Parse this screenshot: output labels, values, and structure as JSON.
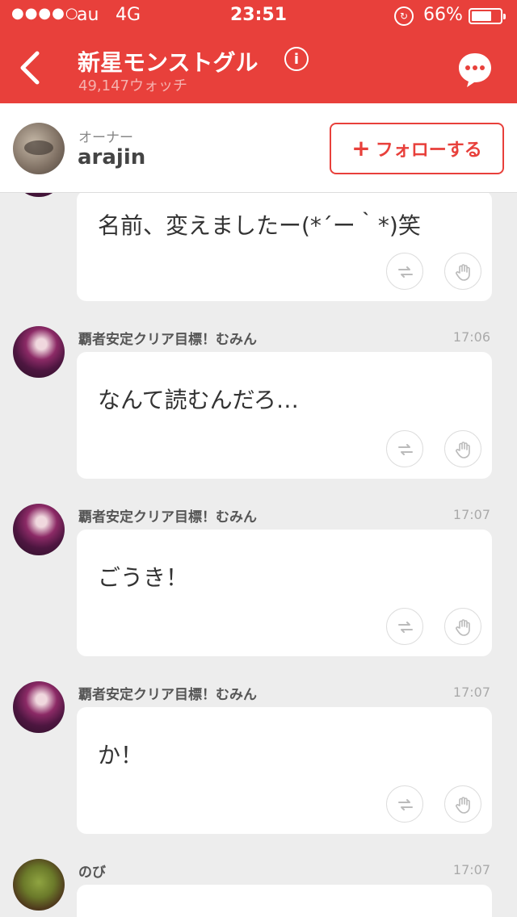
{
  "status": {
    "signal": "●●●●○",
    "carrier": "au",
    "network": "4G",
    "time": "23:51",
    "battery": "66%"
  },
  "header": {
    "title": "新星モンストグル",
    "watchers": "49,147ウォッチ",
    "info_icon": "i"
  },
  "owner": {
    "label": "オーナー",
    "name": "arajin",
    "follow_label": "フォローする",
    "follow_plus": "+"
  },
  "messages": [
    {
      "sender": "",
      "time": "",
      "text": "名前、変えましたー(*´ー｀*)笑"
    },
    {
      "sender": "覇者安定クリア目標！むみん",
      "time": "17:06",
      "text": "なんて読むんだろ…"
    },
    {
      "sender": "覇者安定クリア目標！むみん",
      "time": "17:07",
      "text": "ごうき！"
    },
    {
      "sender": "覇者安定クリア目標！むみん",
      "time": "17:07",
      "text": "か！"
    },
    {
      "sender": "のび",
      "time": "17:07",
      "text": ""
    }
  ],
  "colors": {
    "accent": "#e8403b",
    "background": "#ededed"
  },
  "icons": [
    "back-arrow-icon",
    "info-icon",
    "chat-bubble-icon",
    "retweet-icon",
    "high-five-icon",
    "lock-rotation-icon",
    "battery-icon"
  ]
}
